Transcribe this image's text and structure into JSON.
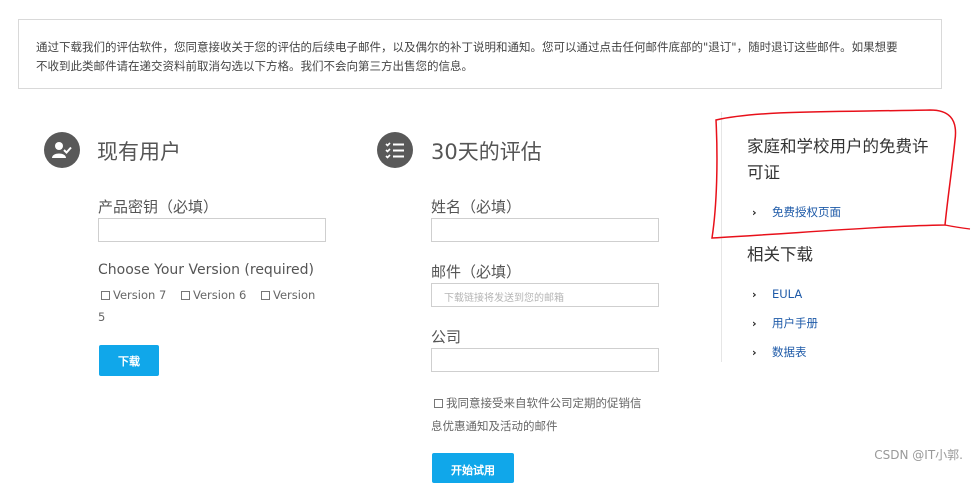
{
  "notice": {
    "line1": "通过下载我们的评估软件，您同意接收关于您的评估的后续电子邮件，以及偶尔的补丁说明和通知。您可以通过点击任何邮件底部的\"退订\"，随时退订这些邮件。如果想要",
    "line2": "不收到此类邮件请在递交资料前取消勾选以下方格。我们不会向第三方出售您的信息。"
  },
  "existing": {
    "title": "现有用户",
    "key_label": "产品密钥（必填）",
    "key_value": "",
    "version_label": "Choose Your Version (required)",
    "versions": [
      "Version 7",
      "Version 6",
      "Version"
    ],
    "version_wrap": "5",
    "download_button": "下载"
  },
  "trial": {
    "title": "30天的评估",
    "name_label": "姓名（必填）",
    "name_value": "",
    "email_label": "邮件（必填）",
    "email_placeholder": "下载链接将发送到您的邮箱",
    "company_label": "公司",
    "company_value": "",
    "consent_line1": "我同意接受来自软件公司定期的促销信",
    "consent_line2": "息优惠通知及活动的邮件",
    "start_button": "开始试用"
  },
  "sidebar": {
    "free_title_1": "家庭和学校用户的免费许",
    "free_title_2": "可证",
    "free_link": "免费授权页面",
    "downloads_title": "相关下载",
    "downloads": [
      "EULA",
      "用户手册",
      "数据表"
    ],
    "chevron": "›"
  },
  "watermark": "CSDN @IT小郭.",
  "colors": {
    "button": "#10a7ea",
    "link": "#1e5aa8",
    "annotation": "#e8101a",
    "icon_bg": "#595959"
  },
  "icons": {
    "existing": "user-check-icon",
    "trial": "checklist-icon"
  }
}
